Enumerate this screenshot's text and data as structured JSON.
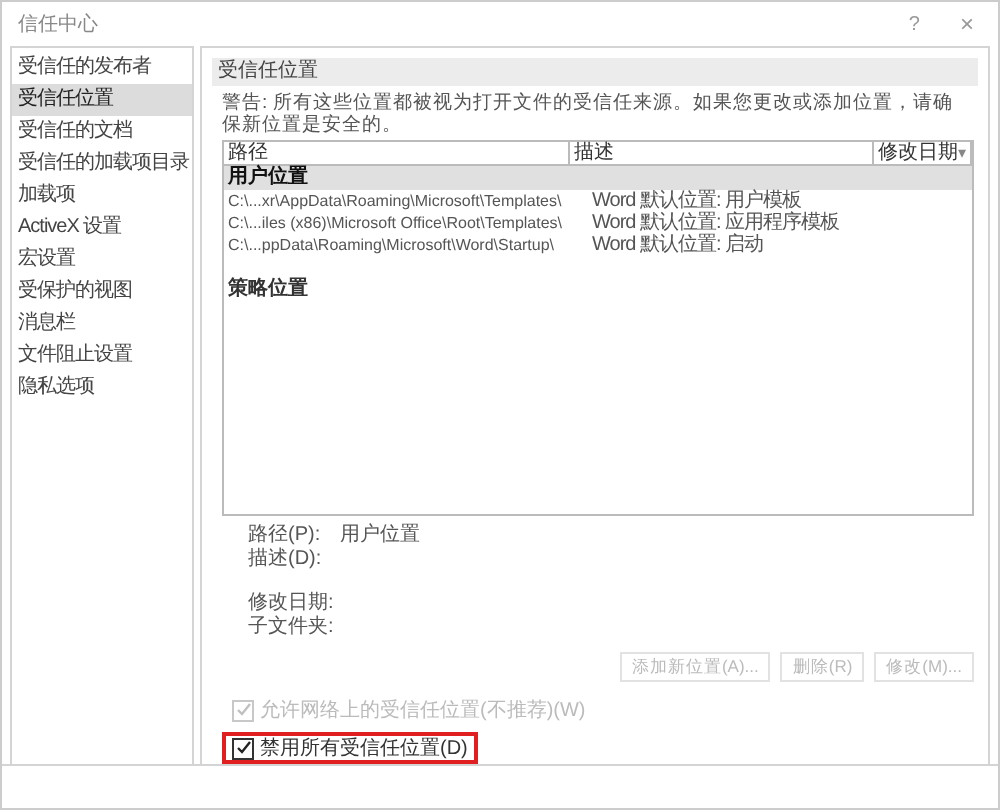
{
  "window": {
    "title": "信任中心",
    "help": "?",
    "close": "×"
  },
  "sidebar": {
    "items": [
      {
        "label": "受信任的发布者",
        "selected": false
      },
      {
        "label": "受信任位置",
        "selected": true
      },
      {
        "label": "受信任的文档",
        "selected": false
      },
      {
        "label": "受信任的加载项目录",
        "selected": false
      },
      {
        "label": "加载项",
        "selected": false
      },
      {
        "label": "ActiveX 设置",
        "selected": false
      },
      {
        "label": "宏设置",
        "selected": false
      },
      {
        "label": "受保护的视图",
        "selected": false
      },
      {
        "label": "消息栏",
        "selected": false
      },
      {
        "label": "文件阻止设置",
        "selected": false
      },
      {
        "label": "隐私选项",
        "selected": false
      }
    ]
  },
  "section_title": "受信任位置",
  "warning": "警告: 所有这些位置都被视为打开文件的受信任来源。如果您更改或添加位置，请确保新位置是安全的。",
  "table": {
    "columns": [
      "路径",
      "描述",
      "修改日期"
    ],
    "sort_indicator": "▾",
    "groups": [
      {
        "title": "用户位置",
        "selected": true,
        "rows": [
          {
            "path": "C:\\...xr\\AppData\\Roaming\\Microsoft\\Templates\\",
            "description": "Word 默认位置: 用户模板"
          },
          {
            "path": "C:\\...iles (x86)\\Microsoft Office\\Root\\Templates\\",
            "description": "Word 默认位置: 应用程序模板"
          },
          {
            "path": "C:\\...ppData\\Roaming\\Microsoft\\Word\\Startup\\",
            "description": "Word 默认位置: 启动"
          }
        ]
      },
      {
        "title": "策略位置",
        "selected": false
      }
    ]
  },
  "details": [
    {
      "label": "路径(P):",
      "value": "用户位置"
    },
    {
      "label": "描述(D):"
    },
    {
      "label": "修改日期:"
    },
    {
      "label": "子文件夹:"
    }
  ],
  "buttons": [
    {
      "label": "添加新位置(A)...",
      "disabled": true
    },
    {
      "label": "删除(R)",
      "disabled": true
    },
    {
      "label": "修改(M)...",
      "disabled": true
    }
  ],
  "options": [
    {
      "label": "允许网络上的受信任位置(不推荐)(W)",
      "checked": true,
      "disabled": true,
      "highlighted": false
    },
    {
      "label": "禁用所有受信任位置(D)",
      "checked": true,
      "disabled": false,
      "highlighted": true
    }
  ]
}
